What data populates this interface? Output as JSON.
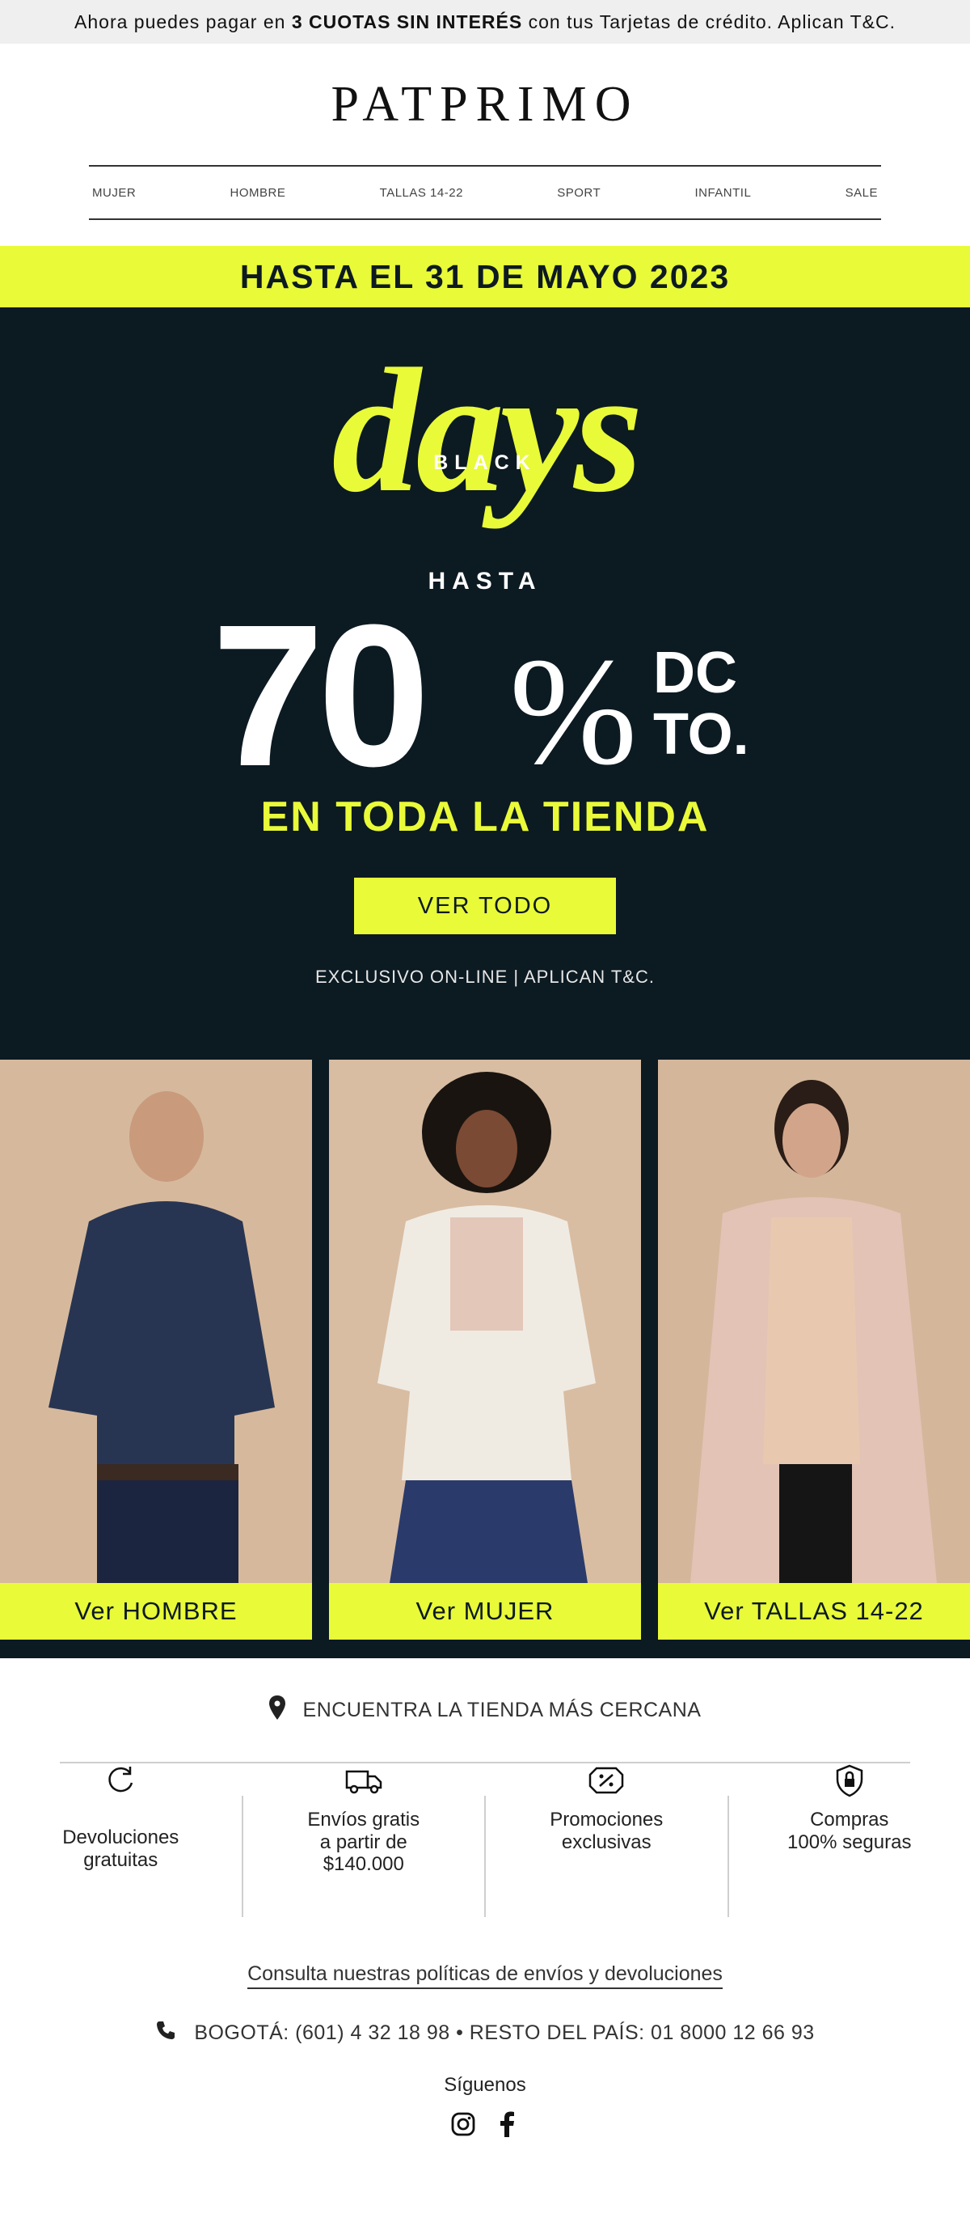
{
  "topbar": {
    "pre": "Ahora puedes pagar en ",
    "bold": "3 CUOTAS SIN INTERÉS",
    "post": " con tus Tarjetas de crédito. Aplican T&C."
  },
  "brand": {
    "logo": "PATPRIMO"
  },
  "nav": {
    "items": [
      "MUJER",
      "HOMBRE",
      "TALLAS 14-22",
      "SPORT",
      "INFANTIL",
      "SALE"
    ]
  },
  "promo": {
    "date_strip": "HASTA EL 31 DE MAYO 2023",
    "days_word": "days",
    "black_word": "BLACK",
    "hasta": "HASTA",
    "number": "70",
    "percent": "%",
    "dc": "DC",
    "to": "TO.",
    "tienda": "EN TODA LA TIENDA",
    "cta": "VER TODO",
    "exclusive": "EXCLUSIVO ON-LINE | APLICAN T&C.",
    "accent_color": "#e9fa38",
    "dark_color": "#0c1a22"
  },
  "tiles": [
    {
      "label": "Ver HOMBRE"
    },
    {
      "label": "Ver MUJER"
    },
    {
      "label": "Ver TALLAS 14-22"
    }
  ],
  "store": {
    "icon": "location-pin-icon",
    "text": "ENCUENTRA LA TIENDA MÁS CERCANA"
  },
  "features": [
    {
      "icon": "refresh-icon",
      "lines": [
        "Devoluciones",
        "gratuitas"
      ]
    },
    {
      "icon": "truck-icon",
      "lines": [
        "Envíos gratis",
        "a partir de",
        "$140.000"
      ]
    },
    {
      "icon": "discount-tag-icon",
      "lines": [
        "Promociones",
        "exclusivas"
      ]
    },
    {
      "icon": "shield-lock-icon",
      "lines": [
        "Compras",
        "100% seguras"
      ]
    }
  ],
  "policy_link": "Consulta nuestras políticas de envíos y devoluciones",
  "phone": {
    "icon": "phone-icon",
    "text": "BOGOTÁ: (601) 4 32 18 98 • RESTO DEL PAÍS: 01 8000 12 66 93"
  },
  "follow": {
    "label": "Síguenos",
    "networks": [
      "instagram-icon",
      "facebook-icon"
    ]
  }
}
